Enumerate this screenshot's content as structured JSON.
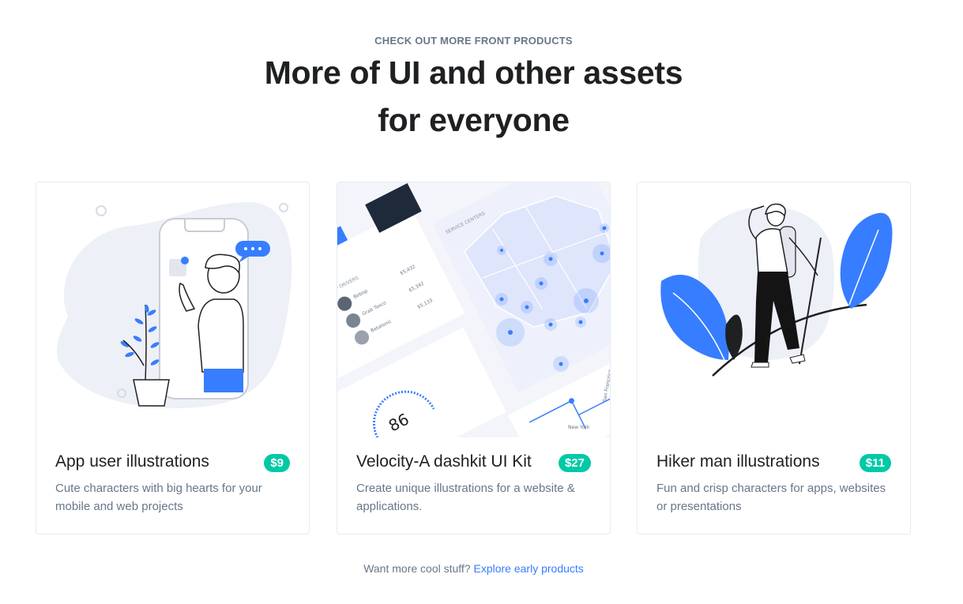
{
  "header": {
    "eyebrow": "CHECK OUT MORE FRONT PRODUCTS",
    "title_line1": "More of UI and other assets",
    "title_line2": "for everyone"
  },
  "cards": [
    {
      "title": "App user illustrations",
      "price": "$9",
      "description": "Cute characters with big hearts for your mobile and web projects"
    },
    {
      "title": "Velocity-A dashkit UI Kit",
      "price": "$27",
      "description": "Create unique illustrations for a website & applications.",
      "preview": {
        "gauge_value": "86",
        "drivers": [
          {
            "name": "Bebop",
            "value": "$5,432"
          },
          {
            "name": "Grab Taxco",
            "value": "$5,342"
          },
          {
            "name": "Betatonic",
            "value": "$5,133"
          }
        ],
        "section_top_drivers": "TOP DRIVERS",
        "section_service_centers": "SERVICE CENTERS",
        "city_new_york": "New York",
        "city_san_francisco": "San Francisco"
      }
    },
    {
      "title": "Hiker man illustrations",
      "price": "$11",
      "description": "Fun and crisp characters for apps, websites or presentations"
    }
  ],
  "footer": {
    "prefix": "Want more cool stuff?",
    "link": "Explore early products"
  },
  "colors": {
    "accent": "#377dff",
    "price_badge": "#00c9a7",
    "muted_text": "#677788",
    "heading": "#1e2022"
  }
}
